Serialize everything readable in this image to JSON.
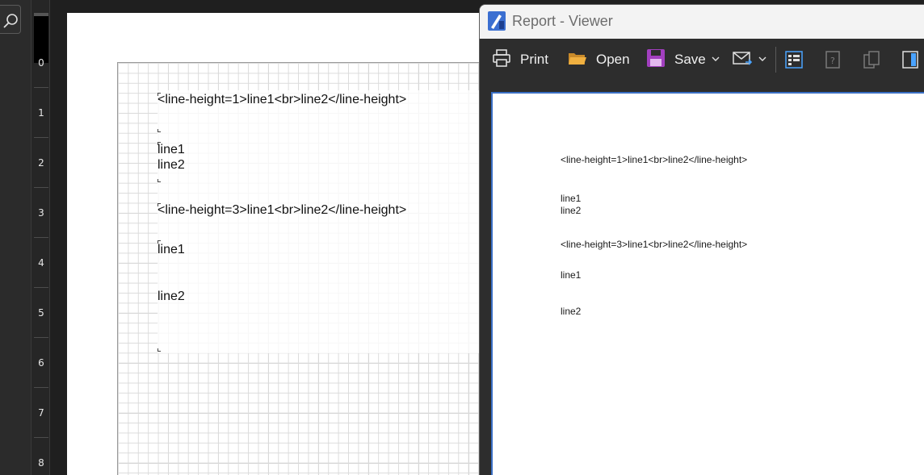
{
  "ruler": {
    "numbers": [
      "0",
      "1",
      "2",
      "3",
      "4",
      "5",
      "6",
      "7",
      "8"
    ]
  },
  "designer": {
    "box1_title": "<line-height=1>line1<br>line2</line-height>",
    "box1_line1": "line1",
    "box1_line2": "line2",
    "box2_title": "<line-height=3>line1<br>line2</line-height>",
    "box2_line1": "line1",
    "box2_line2": "line2"
  },
  "viewer": {
    "title": "Report - Viewer",
    "toolbar": {
      "print_label": "Print",
      "open_label": "Open",
      "save_label": "Save"
    },
    "content": {
      "box1_title": "<line-height=1>line1<br>line2</line-height>",
      "box1_line1": "line1",
      "box1_line2": "line2",
      "box2_title": "<line-height=3>line1<br>line2</line-height>",
      "box2_line1": "line1",
      "box2_line2": "line2"
    }
  },
  "colors": {
    "accent_border": "#3a6fc4",
    "open_folder": "#e8a23a",
    "save_disk": "#b44fc8",
    "toolbar_bg": "#2d2d2d"
  }
}
